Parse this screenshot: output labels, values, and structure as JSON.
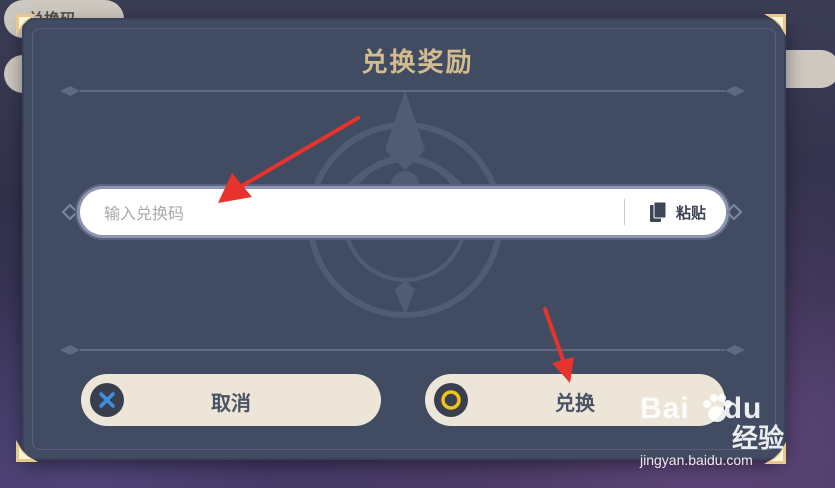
{
  "background": {
    "behind_title": "兑换码"
  },
  "dialog": {
    "title": "兑换奖励",
    "code_input": {
      "value": "",
      "placeholder": "输入兑换码"
    },
    "paste_label": "粘贴",
    "cancel_label": "取消",
    "confirm_label": "兑换"
  },
  "icons": {
    "cancel": "x-circle-icon",
    "confirm": "o-circle-icon",
    "paste": "document-copy-icon"
  },
  "colors": {
    "dialog_bg": "#414b62",
    "title_gold": "#d3bc8e",
    "button_bg": "#ece5d8",
    "cancel_x_blue": "#3d8fe0",
    "confirm_o_gold": "#f0c21a",
    "annotation_red": "#e8322c"
  },
  "watermark": {
    "brand": "Bai",
    "brand_suffix": "du",
    "cn": "经验",
    "url": "jingyan.baidu.com"
  }
}
